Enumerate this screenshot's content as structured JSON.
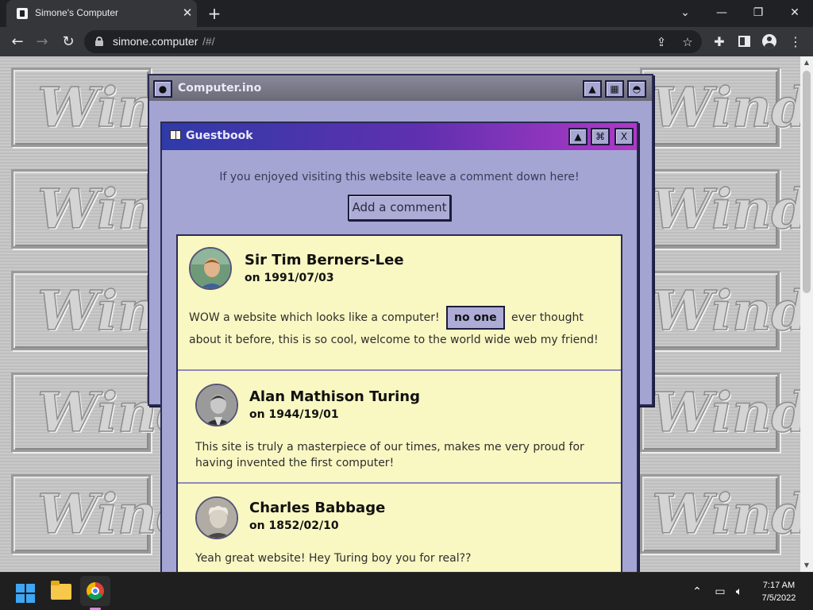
{
  "browser": {
    "tab_title": "Simone's Computer",
    "url_host": "simone.computer",
    "url_path": "/#/"
  },
  "background": {
    "tile_text": "Windo"
  },
  "computer_window": {
    "title": "Computer.ino"
  },
  "guestbook": {
    "title": "Guestbook",
    "intro": "If you enjoyed visiting this website leave a comment down here!",
    "add_button": "Add a comment",
    "comments": [
      {
        "name": "Sir Tim Berners-Lee",
        "date": "on 1991/07/03",
        "body_before": "WOW a website which looks like a computer!",
        "highlight": "no one",
        "body_after": "ever thought about it before, this is so cool, welcome to the world wide web my friend!"
      },
      {
        "name": "Alan Mathison Turing",
        "date": "on 1944/19/01",
        "body": "This site is truly a masterpiece of our times, makes me very proud for having invented the first computer!"
      },
      {
        "name": "Charles Babbage",
        "date": "on 1852/02/10",
        "body": "Yeah great website! Hey Turing boy you for real??"
      }
    ]
  },
  "taskbar": {
    "time": "7:17 AM",
    "date": "7/5/2022"
  },
  "colors": {
    "window_face": "#a5a5d4",
    "comment_bg": "#f9f7c2",
    "guestbook_title_start": "#2f3aa8",
    "guestbook_title_end": "#b039c6"
  }
}
